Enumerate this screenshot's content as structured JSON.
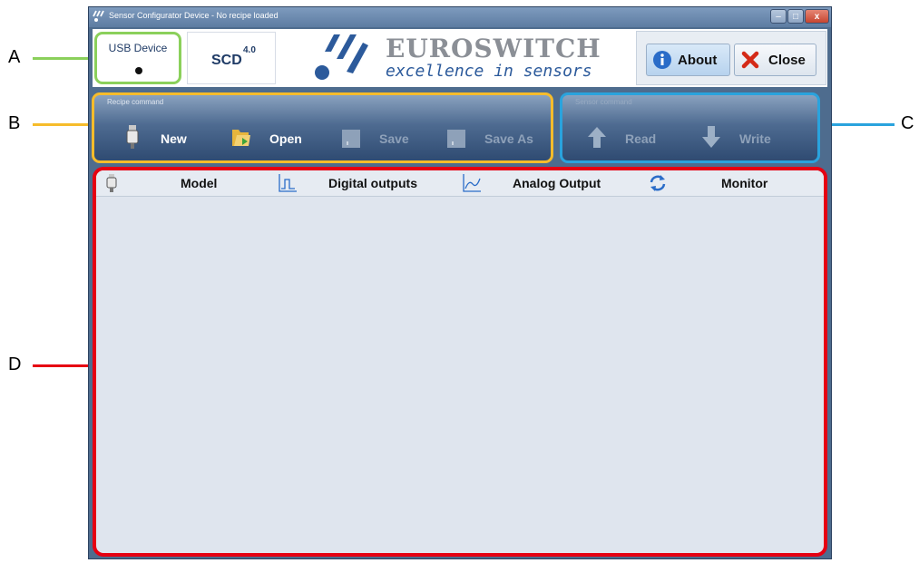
{
  "window": {
    "title": "Sensor Configurator Device - No recipe loaded",
    "app_icon": "euroswitch-logo-icon",
    "controls": {
      "minimize": "–",
      "maximize": "□",
      "close": "x"
    }
  },
  "callouts": {
    "a": "A",
    "b": "B",
    "c": "C",
    "d": "D",
    "colors": {
      "a": "#8bd05b",
      "b": "#f6bc2b",
      "c": "#2aa3dd",
      "d": "#e60012"
    }
  },
  "header": {
    "usb_label": "USB Device",
    "usb_status": "disconnected",
    "scd_label": "SCD",
    "scd_version": "4.0",
    "logo": {
      "name": "EUROSWITCH",
      "tagline": "excellence in sensors"
    },
    "about_label": "About",
    "close_label": "Close"
  },
  "recipe_command": {
    "legend": "Recipe command",
    "buttons": [
      {
        "label": "New",
        "icon": "sensor-icon",
        "enabled": true
      },
      {
        "label": "Open",
        "icon": "folder-open-icon",
        "enabled": true
      },
      {
        "label": "Save",
        "icon": "save-icon",
        "enabled": false
      },
      {
        "label": "Save As",
        "icon": "save-as-icon",
        "enabled": false
      }
    ]
  },
  "sensor_command": {
    "legend": "Sensor command",
    "buttons": [
      {
        "label": "Read",
        "icon": "arrow-up-icon",
        "enabled": false
      },
      {
        "label": "Write",
        "icon": "arrow-down-icon",
        "enabled": false
      }
    ]
  },
  "tabs": [
    {
      "label": "Model",
      "icon": "sensor-icon"
    },
    {
      "label": "Digital outputs",
      "icon": "digital-signal-icon"
    },
    {
      "label": "Analog Output",
      "icon": "analog-signal-icon"
    },
    {
      "label": "Monitor",
      "icon": "refresh-icon"
    }
  ],
  "colors": {
    "window_frame": "#4e6c8e",
    "panel_bg": "#dfe5ee",
    "brand_blue": "#2c5a9b"
  }
}
